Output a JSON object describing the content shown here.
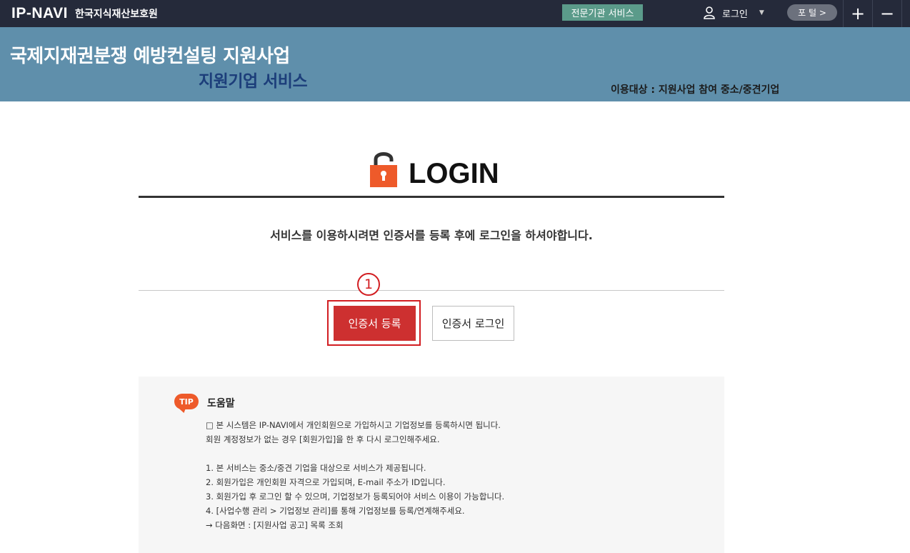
{
  "topbar": {
    "logo_text": "IP-NAVI",
    "org_name": "한국지식재산보호원",
    "expert_service": "전문기관 서비스",
    "login_label": "로그인",
    "portal_label": "포 털 >",
    "zoom_in": "+",
    "zoom_out": "−"
  },
  "banner": {
    "title": "국제지재권분쟁 예방컨설팅 지원사업",
    "subtitle": "지원기업 서비스",
    "target": "이용대상 : 지원사업 참여 중소/중견기업"
  },
  "login": {
    "title": "LOGIN",
    "notice": "서비스를 이용하시려면 인증서를 등록 후에 로그인을 하셔야합니다.",
    "step_marker": "1",
    "register_button": "인증서 등록",
    "cert_login_button": "인증서 로그인"
  },
  "help": {
    "badge": "TIP",
    "title": "도움말",
    "intro": [
      "□ 본 시스템은 IP-NAVI에서 개인회원으로 가입하시고 기업정보를 등록하시면 됩니다.",
      "회원 계정정보가 없는 경우 [회원가입]을 한 후 다시 로그인해주세요."
    ],
    "items": [
      "1. 본 서비스는 중소/중견 기업을 대상으로 서비스가 제공됩니다.",
      "2. 회원가입은 개인회원 자격으로 가입되며, E-mail 주소가 ID입니다.",
      "3. 회원가입 후 로그인 할 수 있으며, 기업정보가 등록되어야 서비스 이용이 가능합니다.",
      "4. [사업수행 관리 > 기업정보 관리]를 통해 기업정보를 등록/연계해주세요.",
      "→ 다음화면 : [지원사업 공고] 목록 조회"
    ]
  },
  "colors": {
    "topbar": "#252a3a",
    "banner": "#5f8fab",
    "accent_red": "#cd3030",
    "lock_orange": "#ee5a2a",
    "expert_green": "#5b9b8a"
  }
}
